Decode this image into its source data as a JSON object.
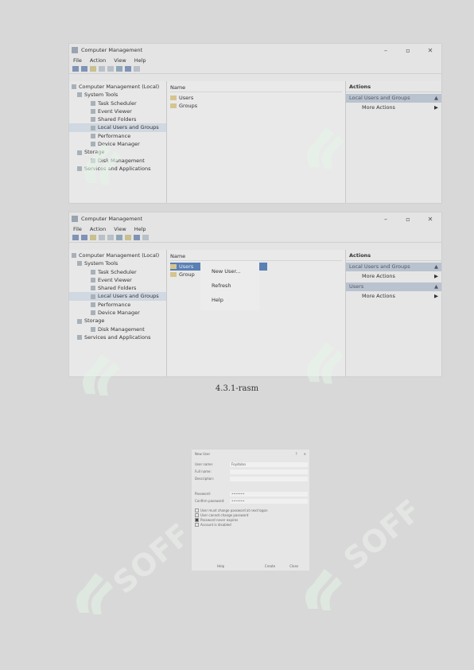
{
  "window1": {
    "title": "Computer Management",
    "menu": [
      "File",
      "Action",
      "View",
      "Help"
    ],
    "tree": [
      {
        "label": "Computer Management (Local)",
        "level": 0
      },
      {
        "label": "System Tools",
        "level": 1
      },
      {
        "label": "Task Scheduler",
        "level": 2
      },
      {
        "label": "Event Viewer",
        "level": 2
      },
      {
        "label": "Shared Folders",
        "level": 2
      },
      {
        "label": "Local Users and Groups",
        "level": 2,
        "selected": true
      },
      {
        "label": "Performance",
        "level": 2
      },
      {
        "label": "Device Manager",
        "level": 2
      },
      {
        "label": "Storage",
        "level": 1
      },
      {
        "label": "Disk Management",
        "level": 2
      },
      {
        "label": "Services and Applications",
        "level": 1
      }
    ],
    "column_header": "Name",
    "items": [
      "Users",
      "Groups"
    ],
    "actions_header": "Actions",
    "actions_section": "Local Users and Groups",
    "actions_item": "More Actions"
  },
  "window2": {
    "title": "Computer Management",
    "menu": [
      "File",
      "Action",
      "View",
      "Help"
    ],
    "tree": [
      {
        "label": "Computer Management (Local)",
        "level": 0
      },
      {
        "label": "System Tools",
        "level": 1
      },
      {
        "label": "Task Scheduler",
        "level": 2
      },
      {
        "label": "Event Viewer",
        "level": 2
      },
      {
        "label": "Shared Folders",
        "level": 2
      },
      {
        "label": "Local Users and Groups",
        "level": 2,
        "selected": true
      },
      {
        "label": "Performance",
        "level": 2
      },
      {
        "label": "Device Manager",
        "level": 2
      },
      {
        "label": "Storage",
        "level": 1
      },
      {
        "label": "Disk Management",
        "level": 2
      },
      {
        "label": "Services and Applications",
        "level": 1
      }
    ],
    "column_header": "Name",
    "items": [
      "Users",
      "Group"
    ],
    "context_menu": [
      "New User...",
      "Refresh",
      "Help"
    ],
    "actions_header": "Actions",
    "actions_section1": "Local Users and Groups",
    "actions_item1": "More Actions",
    "actions_section2": "Users",
    "actions_item2": "More Actions"
  },
  "caption": "4.3.1-rasm",
  "dialog": {
    "title": "New User",
    "fields": [
      {
        "label": "User name:",
        "value": "Foydalan"
      },
      {
        "label": "Full name:",
        "value": ""
      },
      {
        "label": "Description:",
        "value": ""
      },
      {
        "label": "Password:",
        "value": "•••••••"
      },
      {
        "label": "Confirm password:",
        "value": "•••••••"
      }
    ],
    "checkboxes": [
      {
        "label": "User must change password at next logon",
        "checked": false
      },
      {
        "label": "User cannot change password",
        "checked": false
      },
      {
        "label": "Password never expires",
        "checked": true
      },
      {
        "label": "Account is disabled",
        "checked": false
      }
    ],
    "help_label": "Help",
    "create_label": "Create",
    "close_label": "Close"
  },
  "watermark_text": "SOFF"
}
